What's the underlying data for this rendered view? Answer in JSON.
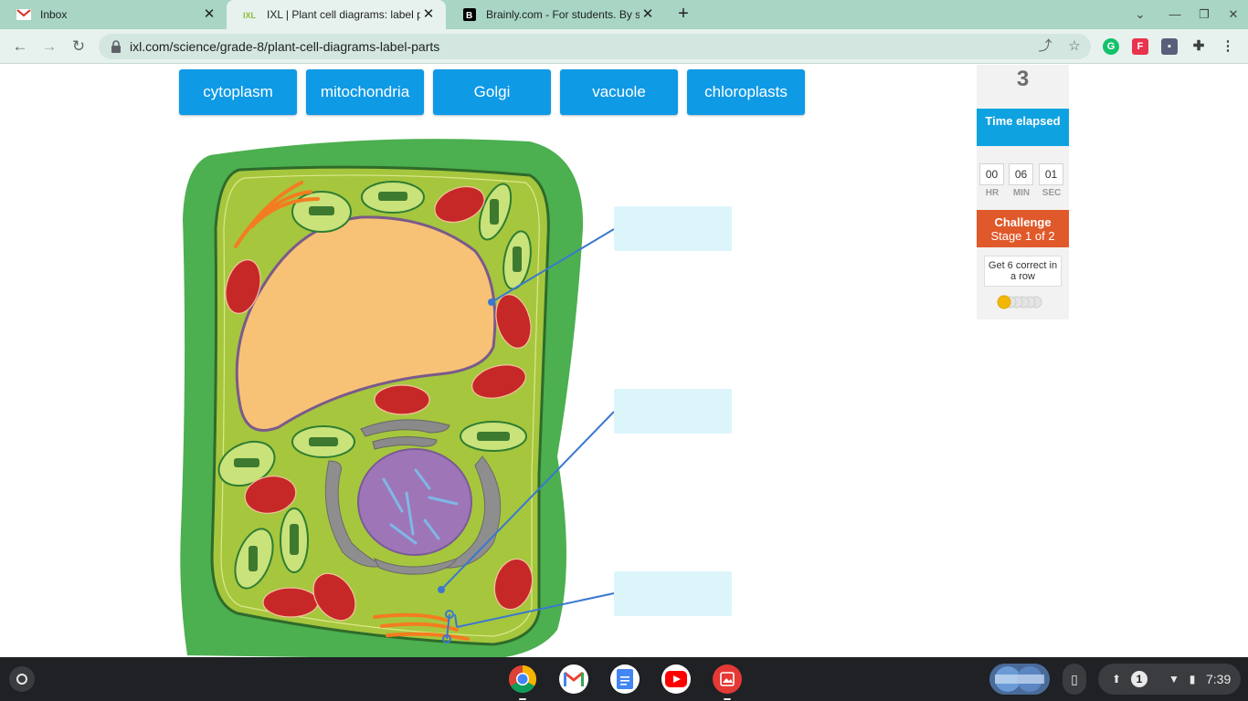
{
  "browser": {
    "tabs": [
      {
        "title": "Inbox",
        "favicon": "gmail-favicon",
        "active": false
      },
      {
        "title": "IXL | Plant cell diagrams: label p",
        "favicon": "ixl-favicon",
        "active": true
      },
      {
        "title": "Brainly.com - For students. By st",
        "favicon": "brainly-favicon",
        "active": false
      }
    ],
    "url": "ixl.com/science/grade-8/plant-cell-diagrams-label-parts"
  },
  "word_bank": [
    "cytoplasm",
    "mitochondria",
    "Golgi",
    "vacuole",
    "chloroplasts"
  ],
  "drop_targets": [
    {
      "value": ""
    },
    {
      "value": ""
    },
    {
      "value": ""
    }
  ],
  "sidebar": {
    "score": "3",
    "time_heading": "Time elapsed",
    "time": {
      "hr": "00",
      "min": "06",
      "sec": "01"
    },
    "time_labels": {
      "hr": "HR",
      "min": "MIN",
      "sec": "SEC"
    },
    "challenge_title": "Challenge",
    "challenge_stage": "Stage 1 of 2",
    "streak_text": "Get 6 correct in a row",
    "streak_progress": 1,
    "streak_total": 6
  },
  "shelf": {
    "apps": [
      "chrome-icon",
      "gmail-icon",
      "docs-icon",
      "youtube-icon",
      "gallery-icon"
    ],
    "notification_count": "1",
    "clock": "7:39"
  },
  "colors": {
    "tile_blue": "#0f9ae6",
    "challenge_orange": "#e0592a",
    "time_blue": "#0fa2e0",
    "cell_wall": "#4caf50",
    "cytoplasm": "#a6c63e",
    "vacuole": "#f7c276",
    "nucleus": "#9e76b8"
  }
}
